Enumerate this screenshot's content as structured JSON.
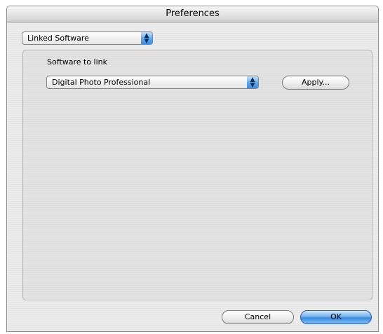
{
  "window": {
    "title": "Preferences"
  },
  "category_popup": {
    "selected": "Linked Software"
  },
  "linked_software": {
    "label": "Software to link",
    "software_popup": {
      "selected": "Digital Photo Professional"
    },
    "apply_button": "Apply..."
  },
  "footer": {
    "cancel_button": "Cancel",
    "ok_button": "OK"
  },
  "colors": {
    "accent": "#5da9ef",
    "default_button": "#3a88dc"
  }
}
